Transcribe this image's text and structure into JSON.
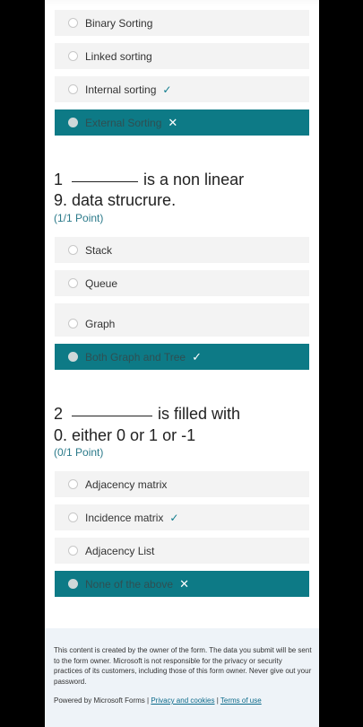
{
  "q_prev": {
    "options": [
      {
        "label": "Binary Sorting",
        "mark": ""
      },
      {
        "label": "Linked sorting",
        "mark": ""
      },
      {
        "label": "Internal sorting",
        "mark": "✓"
      },
      {
        "label": "External Sorting",
        "mark": "✕"
      }
    ]
  },
  "q19": {
    "line1_num": "1",
    "line1_text": "is a non linear",
    "line2": "9. data strucrure.",
    "points": "(1/1 Point)",
    "options": [
      {
        "label": "Stack",
        "mark": ""
      },
      {
        "label": "Queue",
        "mark": ""
      },
      {
        "label": "Graph",
        "mark": ""
      },
      {
        "label": "Both Graph and Tree",
        "mark": "✓"
      }
    ]
  },
  "q20": {
    "line1_num": "2",
    "line1_text": "is filled with",
    "line2": "0. either 0 or 1 or -1",
    "points": "(0/1 Point)",
    "options": [
      {
        "label": "Adjacency matrix",
        "mark": ""
      },
      {
        "label": "Incidence matrix",
        "mark": "✓"
      },
      {
        "label": "Adjacency List",
        "mark": ""
      },
      {
        "label": "None of the above",
        "mark": "✕"
      }
    ]
  },
  "footer": {
    "disclaimer": "This content is created by the owner of the form. The data you submit will be sent to the form owner. Microsoft is not responsible for the privacy or security practices of its customers, including those of this form owner. Never give out your password.",
    "powered": "Powered by Microsoft Forms |",
    "privacy_link": "Privacy and cookies",
    "sep": "|",
    "terms_link": "Terms of use"
  }
}
